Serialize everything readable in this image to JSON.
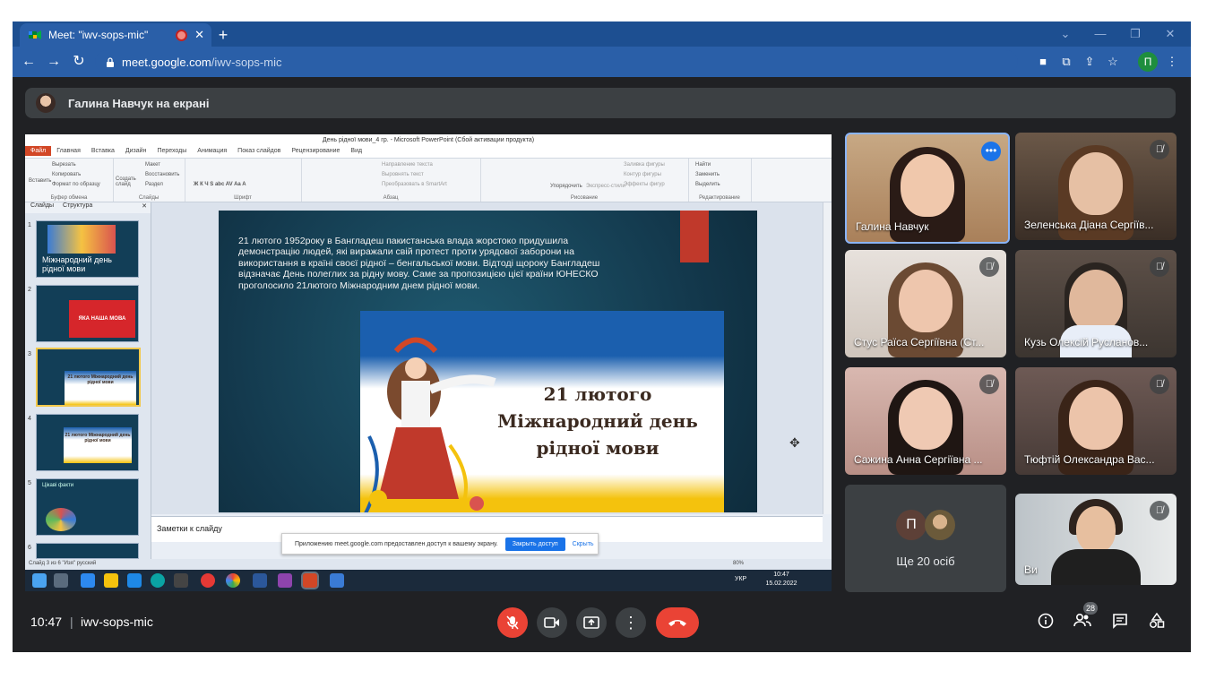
{
  "browser": {
    "tab_title": "Meet: \"iwv-sops-mic\"",
    "tab_close": "✕",
    "new_tab": "+",
    "url_host": "meet.google.com",
    "url_path": "/iwv-sops-mic",
    "profile_initial": "П",
    "window_controls": [
      "⌄",
      "—",
      "❐",
      "✕"
    ]
  },
  "banner": {
    "text": "Галина Навчук на екрані"
  },
  "powerpoint": {
    "window_title": "День рідної мови_4 гр. - Microsoft PowerPoint (Сбой активации продукта)",
    "ribbon_tabs": [
      "Файл",
      "Главная",
      "Вставка",
      "Дизайн",
      "Переходы",
      "Анимация",
      "Показ слайдов",
      "Рецензирование",
      "Вид"
    ],
    "ribbon_groups": [
      "Буфер обмена",
      "Слайды",
      "Шрифт",
      "Абзац",
      "Рисование",
      "Редактирование"
    ],
    "ribbon_buttons": {
      "paste": "Вставить",
      "cut": "Вырезать",
      "copy": "Копировать",
      "format": "Формат по образцу",
      "new_slide": "Создать слайд",
      "layout": "Макет",
      "restore": "Восстановить",
      "section": "Раздел",
      "text_direction": "Направление текста",
      "align_text": "Выровнять текст",
      "convert_smartart": "Преобразовать в SmartArt",
      "arrange": "Упорядочить",
      "quick_styles": "Экспресс-стили",
      "shape_fill": "Заливка фигуры",
      "shape_outline": "Контур фигуры",
      "shape_effects": "Эффекты фигур",
      "find": "Найти",
      "replace": "Заменить",
      "select": "Выделить"
    },
    "thumb_tabs": [
      "Слайды",
      "Структура"
    ],
    "thumbs": [
      {
        "num": "1",
        "text": "Міжнародний день рідної мови"
      },
      {
        "num": "2",
        "text": "ЯКА НАША МОВА"
      },
      {
        "num": "3",
        "text": "21 лютого Міжнародний день рідної мови"
      },
      {
        "num": "4",
        "text": "21 лютого Міжнародний день рідної мови"
      },
      {
        "num": "5",
        "text": "Цікаві факти"
      },
      {
        "num": "6",
        "text": ""
      }
    ],
    "slide": {
      "body": "21 лютого 1952року в Бангладеш пакистанська влада жорстоко придушила демонстрацію людей, які виражали свій протест проти урядової заборони на використання в країні своєї рідної – бенгальської мови. Відтоді щороку Бангладеш відзначає День полеглих за рідну мову. Саме за пропозицією цієї країни ЮНЕСКО проголосило 21лютого Міжнародним днем рідної мови.",
      "headline1": "21 лютого",
      "headline2": "Міжнародний день",
      "headline3": "рідної мови"
    },
    "notes_placeholder": "Заметки к слайду",
    "status_left": "Слайд 3 из 6   \"Изя\"   русский",
    "zoom": "80%",
    "taskbar_time": "10:47",
    "taskbar_date": "15.02.2022",
    "taskbar_lang": "УКР"
  },
  "share_notice": {
    "text": "Приложению meet.google.com предоставлен доступ к вашему экрану.",
    "stop_button": "Закрыть доступ",
    "hide_link": "Скрыть"
  },
  "participants": [
    {
      "name": "Галина Навчук",
      "muted": false,
      "active": true
    },
    {
      "name": "Зеленська Діана Сергіїв...",
      "muted": true
    },
    {
      "name": "Стус Раїса Сергіївна (Ст...",
      "muted": true
    },
    {
      "name": "Кузь Олексій Русланов...",
      "muted": true
    },
    {
      "name": "Сажина Анна Сергіївна ...",
      "muted": true
    },
    {
      "name": "Тюфтій Олександра Вас...",
      "muted": true
    },
    {
      "name": "Ще 20 осіб",
      "muted": false,
      "avatar_initial": "П"
    },
    {
      "name": "Ви",
      "muted": true
    }
  ],
  "bottom_bar": {
    "time": "10:47",
    "separator": "|",
    "meeting_code": "iwv-sops-mic",
    "participant_count": "28"
  },
  "colors": {
    "meet_bg": "#202124",
    "tab_bar": "#1d4f91",
    "danger": "#ea4335",
    "accent": "#1a73e8"
  }
}
